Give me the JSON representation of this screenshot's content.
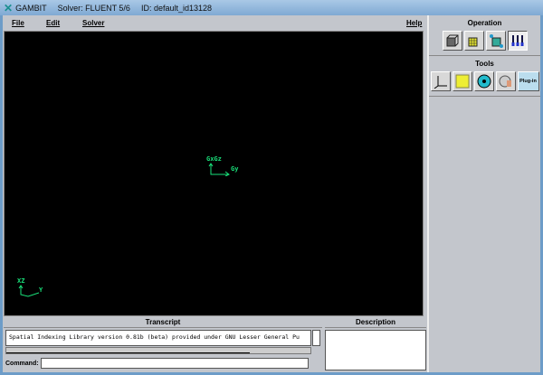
{
  "window": {
    "app": "GAMBIT",
    "solver": "Solver: FLUENT 5/6",
    "id": "ID: default_id13128"
  },
  "menu": {
    "file": "File",
    "edit": "Edit",
    "solver": "Solver",
    "help": "Help"
  },
  "axes": {
    "center_label": "GxGz",
    "center_y": "Gy",
    "corner_label": "XZ",
    "corner_y": "Y"
  },
  "operation": {
    "title": "Operation",
    "buttons": [
      "geometry",
      "mesh",
      "zones",
      "tools"
    ]
  },
  "tools": {
    "title": "Tools",
    "buttons": [
      "coordinate-system",
      "specify-color",
      "view-fan",
      "orient-model",
      "Plug-in"
    ]
  },
  "transcript": {
    "title": "Transcript",
    "text": "Spatial Indexing Library version 0.81b (beta) provided under GNU Lesser General Pu"
  },
  "description": {
    "title": "Description"
  },
  "command": {
    "label": "Command:",
    "value": ""
  },
  "colors": {
    "canvas": "#000000",
    "axes": "#19e07a",
    "panel": "#c3c6cc"
  }
}
